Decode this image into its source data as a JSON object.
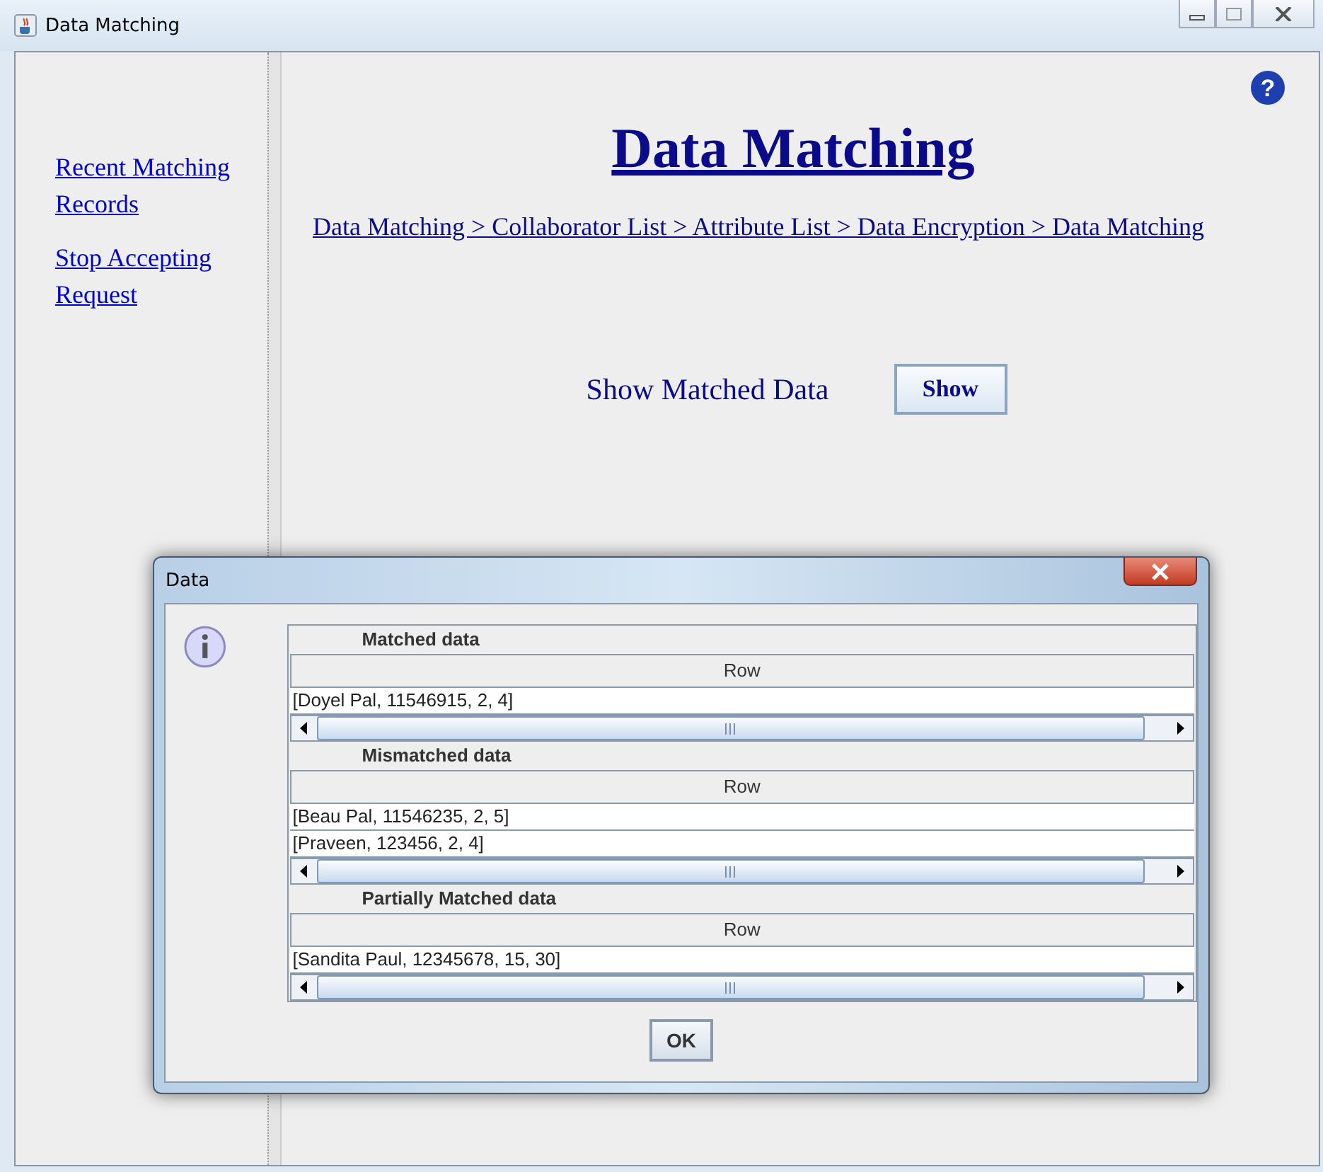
{
  "window": {
    "title": "Data Matching"
  },
  "sidebar": {
    "links": [
      "Recent Matching Records",
      "Stop Accepting Request"
    ]
  },
  "header": {
    "help": "?",
    "title": "Data Matching",
    "breadcrumb": "Data Matching > Collaborator List > Attribute List > Data Encryption > Data Matching"
  },
  "show": {
    "label": "Show Matched Data",
    "button": "Show"
  },
  "dialog": {
    "title": "Data",
    "sections": [
      {
        "heading": "Matched data",
        "column": "Row",
        "rows": [
          "[Doyel Pal, 11546915, 2, 4]"
        ]
      },
      {
        "heading": "Mismatched data",
        "column": "Row",
        "rows": [
          "[Beau Pal, 11546235, 2, 5]",
          "[Praveen, 123456, 2, 4]"
        ]
      },
      {
        "heading": "Partially Matched data",
        "column": "Row",
        "rows": [
          "[Sandita Paul, 12345678, 15, 30]"
        ]
      }
    ],
    "ok_button": "OK"
  }
}
